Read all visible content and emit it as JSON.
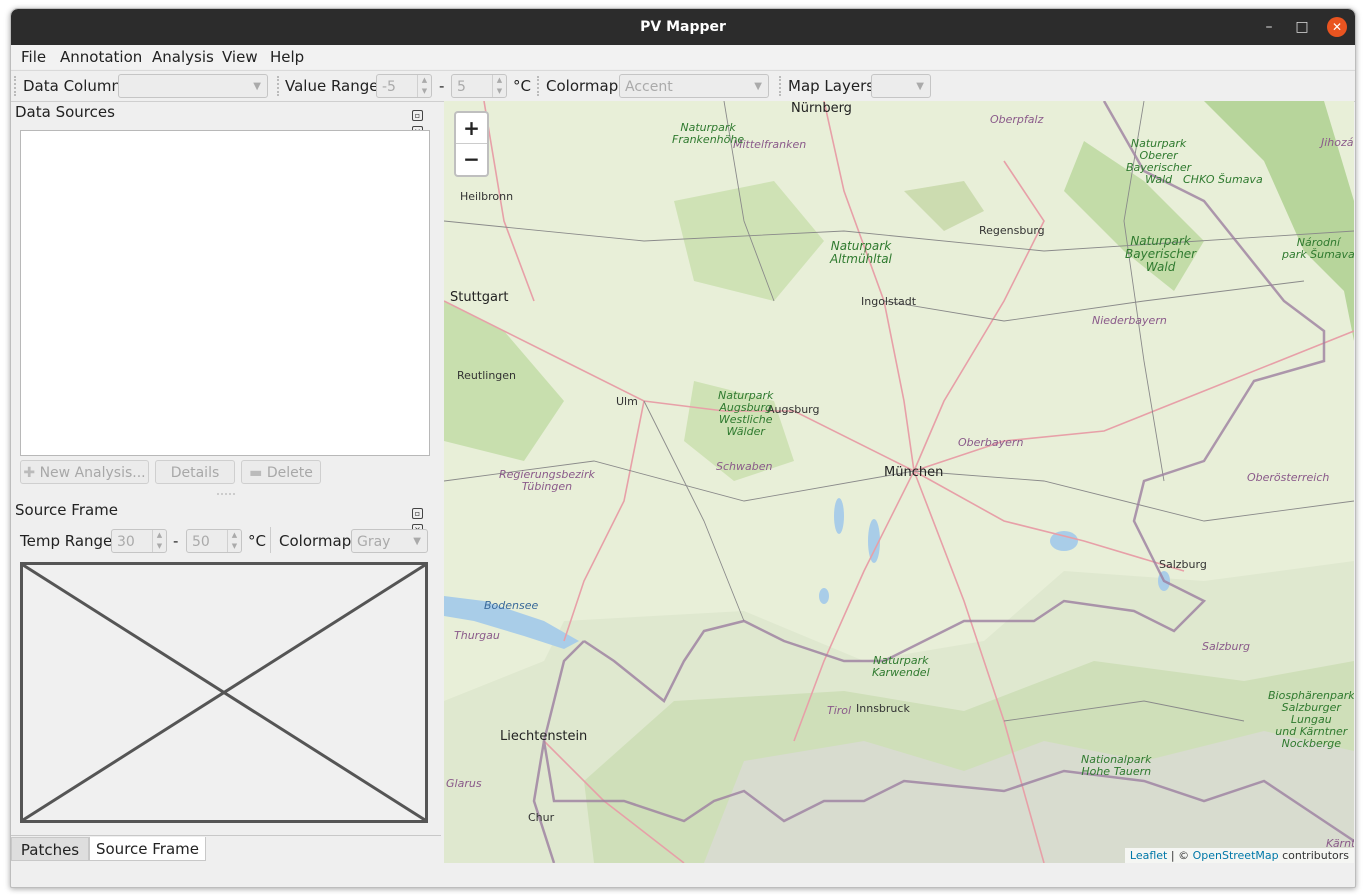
{
  "window": {
    "title": "PV Mapper"
  },
  "menu": [
    "File",
    "Annotation",
    "Analysis",
    "View",
    "Help"
  ],
  "toolbar": {
    "data_column_label": "Data Column",
    "data_column_value": "",
    "value_range_label": "Value Range",
    "value_min": "-5",
    "range_sep": "-",
    "value_max": "5",
    "unit": "°C",
    "colormap_label": "Colormap",
    "colormap_value": "Accent",
    "map_layers_label": "Map Layers",
    "map_layers_value": ""
  },
  "data_sources": {
    "title": "Data Sources",
    "buttons": {
      "new_analysis": "New Analysis...",
      "details": "Details",
      "delete": "Delete"
    }
  },
  "source_frame": {
    "title": "Source Frame",
    "temp_range_label": "Temp Range",
    "temp_min": "30",
    "range_sep": "-",
    "temp_max": "50",
    "unit": "°C",
    "colormap_label": "Colormap",
    "colormap_value": "Gray"
  },
  "tabs": [
    "Patches",
    "Source Frame"
  ],
  "map": {
    "zoom_in": "+",
    "zoom_out": "−",
    "attribution": {
      "leaflet": "Leaflet",
      "sep": " | © ",
      "osm": "OpenStreetMap",
      "suffix": " contributors"
    },
    "places": {
      "nurnberg": "Nürnberg",
      "mittelfranken": "Mittelfranken",
      "oberpfalz": "Oberpfalz",
      "heilbronn": "Heilbronn",
      "regensburg": "Regensburg",
      "stuttgart": "Stuttgart",
      "ingolstadt": "Ingolstadt",
      "niederbayern": "Niederbayern",
      "reutlingen": "Reutlingen",
      "ulm": "Ulm",
      "augsburg": "Augsburg",
      "oberbayern": "Oberbayern",
      "munchen": "München",
      "schwaben": "Schwaben",
      "tubingen_1": "Regierungsbezirk",
      "tubingen_2": "Tübingen",
      "oberosterreich": "Oberösterreich",
      "salzburg_city": "Salzburg",
      "salzburg_region": "Salzburg",
      "bodensee": "Bodensee",
      "thurgau": "Thurgau",
      "liechtenstein": "Liechtenstein",
      "tirol": "Tirol",
      "innsbruck": "Innsbruck",
      "glarus": "Glarus",
      "chur": "Chur",
      "jihozapadni": "Jihozá",
      "chko": "CHKO Šumava",
      "karnten": "Kärnte",
      "np_frankenhohe_1": "Naturpark",
      "np_frankenhohe_2": "Frankenhöhe",
      "np_oberer_1": "Naturpark",
      "np_oberer_2": "Oberer",
      "np_oberer_3": "Bayerischer",
      "np_oberer_4": "Wald",
      "np_altmuhl_1": "Naturpark",
      "np_altmuhl_2": "Altmühltal",
      "np_bayer_1": "Naturpark",
      "np_bayer_2": "Bayerischer",
      "np_bayer_3": "Wald",
      "np_sumava_1": "Národní",
      "np_sumava_2": "park Šumava",
      "np_augsburg_1": "Naturpark",
      "np_augsburg_2": "Augsburg",
      "np_augsburg_3": "Westliche",
      "np_augsburg_4": "Wälder",
      "np_karwendel_1": "Naturpark",
      "np_karwendel_2": "Karwendel",
      "np_hohe_1": "Nationalpark",
      "np_hohe_2": "Hohe Tauern",
      "bio_1": "Biosphärenpark",
      "bio_2": "Salzburger",
      "bio_3": "Lungau",
      "bio_4": "und Kärntner",
      "bio_5": "Nockberge"
    }
  }
}
